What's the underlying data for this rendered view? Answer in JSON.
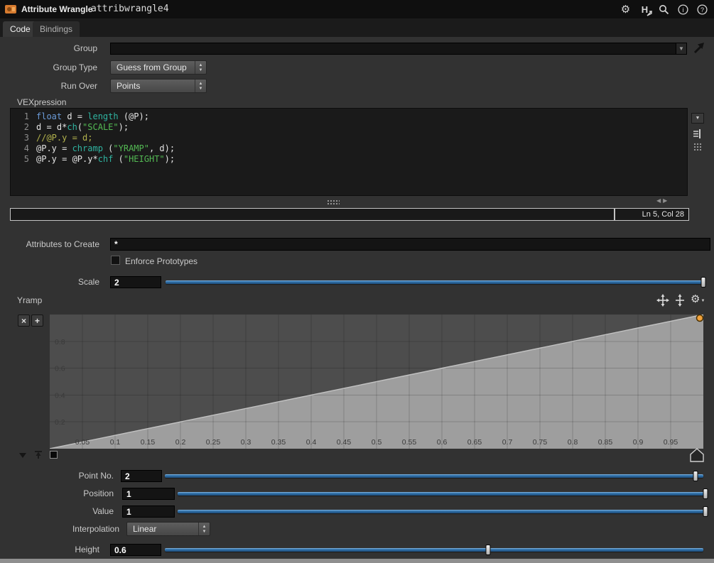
{
  "header": {
    "title": "Attribute Wrangle",
    "node_name": "attribwrangle4"
  },
  "tabs": {
    "code": "Code",
    "bindings": "Bindings"
  },
  "glyphs": {
    "up": "▲",
    "down": "▼",
    "left": "◀",
    "right": "▶",
    "gear": "⚙",
    "houdini_h": "H",
    "close": "×",
    "plus": "+"
  },
  "form": {
    "group": {
      "label": "Group",
      "value": ""
    },
    "group_type": {
      "label": "Group Type",
      "value": "Guess from Group"
    },
    "run_over": {
      "label": "Run Over",
      "value": "Points"
    },
    "vexpression_label": "VEXpression",
    "status": {
      "cursor": "Ln 5, Col 28"
    },
    "attributes": {
      "label": "Attributes to Create",
      "value": "*"
    },
    "enforce_prototypes": {
      "label": "Enforce Prototypes",
      "checked": false
    },
    "scale": {
      "label": "Scale",
      "value": "2",
      "fraction": 1
    },
    "yramp_label": "Yramp",
    "point_no": {
      "label": "Point No.",
      "value": "2",
      "fraction": 0.985
    },
    "position": {
      "label": "Position",
      "value": "1",
      "fraction": 1
    },
    "value": {
      "label": "Value",
      "value": "1",
      "fraction": 1
    },
    "interpolation": {
      "label": "Interpolation",
      "value": "Linear"
    },
    "height": {
      "label": "Height",
      "value": "0.6",
      "fraction": 0.6
    }
  },
  "code": {
    "lines": [
      {
        "no": "1",
        "segments": [
          {
            "t": "float",
            "c": "kw"
          },
          {
            "t": " d = ",
            "c": "pl"
          },
          {
            "t": "length",
            "c": "fn"
          },
          {
            "t": " (@P);",
            "c": "pl"
          }
        ]
      },
      {
        "no": "2",
        "segments": [
          {
            "t": "d = d*",
            "c": "pl"
          },
          {
            "t": "ch",
            "c": "fn"
          },
          {
            "t": "(",
            "c": "pl"
          },
          {
            "t": "\"SCALE\"",
            "c": "str"
          },
          {
            "t": ");",
            "c": "pl"
          }
        ]
      },
      {
        "no": "3",
        "segments": [
          {
            "t": "//@P.y = d;",
            "c": "cm"
          }
        ]
      },
      {
        "no": "4",
        "segments": [
          {
            "t": "@P.y = ",
            "c": "pl"
          },
          {
            "t": "chramp",
            "c": "fn"
          },
          {
            "t": " (",
            "c": "pl"
          },
          {
            "t": "\"YRAMP\"",
            "c": "str"
          },
          {
            "t": ", d);",
            "c": "pl"
          }
        ]
      },
      {
        "no": "5",
        "segments": [
          {
            "t": "@P.y = @P.y*",
            "c": "pl"
          },
          {
            "t": "chf",
            "c": "fn"
          },
          {
            "t": " (",
            "c": "pl"
          },
          {
            "t": "\"HEIGHT\"",
            "c": "str"
          },
          {
            "t": ");",
            "c": "pl"
          }
        ]
      }
    ]
  },
  "chart_data": {
    "type": "area",
    "title": "Yramp",
    "points": [
      {
        "position": 0,
        "value": 0
      },
      {
        "position": 1,
        "value": 1
      }
    ],
    "interpolation": "Linear",
    "selected_point_index": 1,
    "xlim": [
      0,
      1
    ],
    "ylim": [
      0,
      1
    ],
    "x_ticks": [
      0.05,
      0.1,
      0.15,
      0.2,
      0.25,
      0.3,
      0.35,
      0.4,
      0.45,
      0.5,
      0.55,
      0.6,
      0.65,
      0.7,
      0.75,
      0.8,
      0.85,
      0.9,
      0.95
    ],
    "y_ticks": [
      0.2,
      0.4,
      0.6,
      0.8
    ],
    "grid": true,
    "colors": {
      "bg": "#4d4d4d",
      "fill": "#9e9e9e",
      "line": "#c2c2c2",
      "grid": "rgba(0,0,0,0.18)",
      "tick_text": "#3a3a3a",
      "selected_point": "#f0a23c"
    }
  },
  "icons": {
    "header": [
      "gear-icon",
      "houdini-select-icon",
      "search-icon",
      "info-icon",
      "help-icon"
    ],
    "ramp_toolbar": [
      "move-all-icon",
      "move-frame-icon",
      "gear-icon"
    ]
  },
  "colors": {
    "accent_blue": "#2f6fae",
    "panel_bg": "#323232",
    "header_bg": "#0f0f0f",
    "editor_bg": "#1a1a1a",
    "input_bg": "#141414",
    "node_icon_orange": "#d77b2f"
  }
}
